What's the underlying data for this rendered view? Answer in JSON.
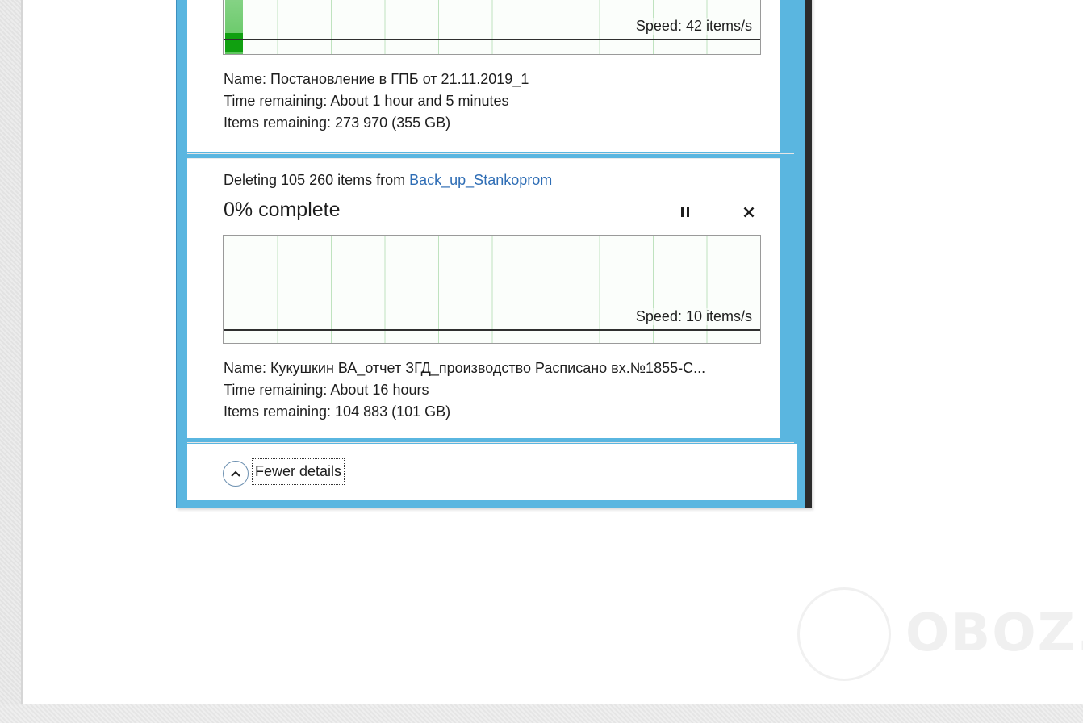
{
  "operation1": {
    "speed": "Speed: 42 items/s",
    "name": "Name:  Постановление в ГПБ от 21.11.2019_1",
    "time_remaining": "Time remaining:  About 1 hour and 5 minutes",
    "items_remaining": "Items remaining:  273 970 (355 GB)"
  },
  "operation2": {
    "deleting_prefix": "Deleting 105 260 items from ",
    "deleting_target": "Back_up_Stankoprom",
    "percent_complete": "0% complete",
    "progress": 0,
    "speed": "Speed: 10 items/s",
    "name": "Name:  Кукушкин ВА_отчет ЗГД_производство Расписано вх.№1855-С...",
    "time_remaining": "Time remaining:  About 16 hours",
    "items_remaining": "Items remaining:  104 883 (101 GB)"
  },
  "footer": {
    "fewer_details_label": "Fewer details",
    "chevron_icon": "chevron-up-icon"
  },
  "watermark": {
    "text": "OBOZ.UA"
  },
  "colors": {
    "window_frame": "#5ab6e0",
    "graph_grid": "#bfe3bf",
    "progress_green": "#10a010",
    "link_blue": "#2e6db5"
  }
}
